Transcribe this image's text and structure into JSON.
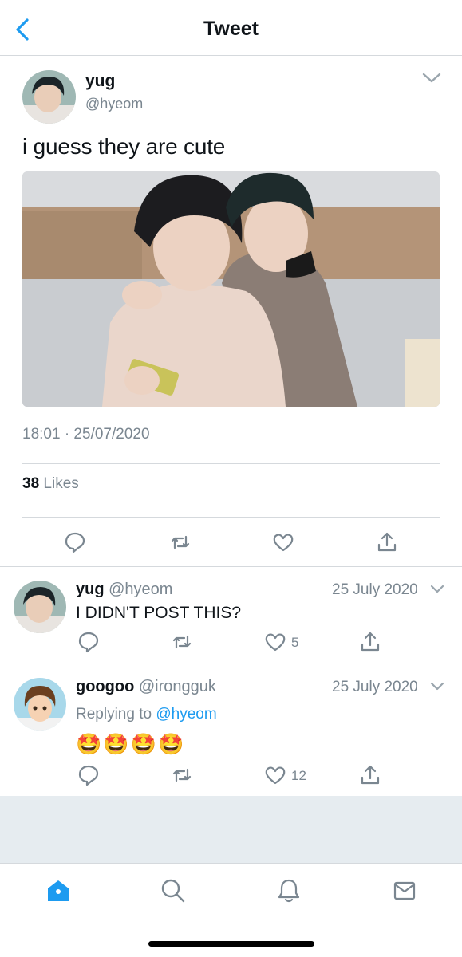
{
  "header": {
    "title": "Tweet",
    "back_icon": "chevron-left-icon"
  },
  "tweet": {
    "author_name": "yug",
    "author_handle": "@hyeom",
    "text": "i guess they are cute",
    "timestamp": "18:01 · 25/07/2020",
    "likes_count": "38",
    "likes_label": "Likes",
    "actions": [
      "reply-icon",
      "retweet-icon",
      "like-icon",
      "share-icon"
    ]
  },
  "replies": [
    {
      "name": "yug",
      "handle": "@hyeom",
      "date": "25 July 2020",
      "text": "I DIDN'T POST THIS?",
      "like_count": "5"
    },
    {
      "name": "googoo",
      "handle": "@irongguk",
      "date": "25 July 2020",
      "replying_prefix": "Replying to",
      "replying_to": "@hyeom",
      "emojis": "🤩🤩🤩🤩",
      "like_count": "12"
    }
  ],
  "tabs": [
    "home-icon",
    "search-icon",
    "notifications-icon",
    "messages-icon"
  ],
  "colors": {
    "accent": "#1d9bf0",
    "secondary_text": "#7a8690",
    "divider": "#d5d9dd",
    "background_gray": "#e6ecf0"
  }
}
